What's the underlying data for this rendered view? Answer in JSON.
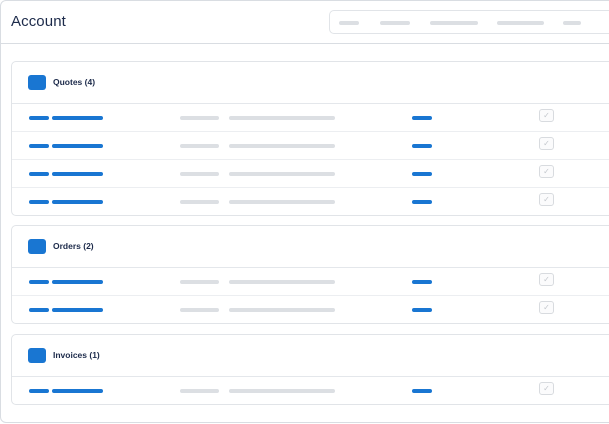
{
  "header": {
    "title": "Account",
    "tabs": [
      "",
      "",
      "",
      "",
      ""
    ]
  },
  "sections": [
    {
      "id": "quotes",
      "title": "Quotes (4)",
      "rows": 4
    },
    {
      "id": "orders",
      "title": "Orders (2)",
      "rows": 2
    },
    {
      "id": "invoices",
      "title": "Invoices (1)",
      "rows": 1
    }
  ],
  "colors": {
    "accent": "#1976d2",
    "placeholder": "#dcdfe3",
    "title_text": "#1c2a4a",
    "border": "#d9dde2"
  },
  "icons": {
    "section": "section-square-icon",
    "row_check": "check-icon"
  }
}
